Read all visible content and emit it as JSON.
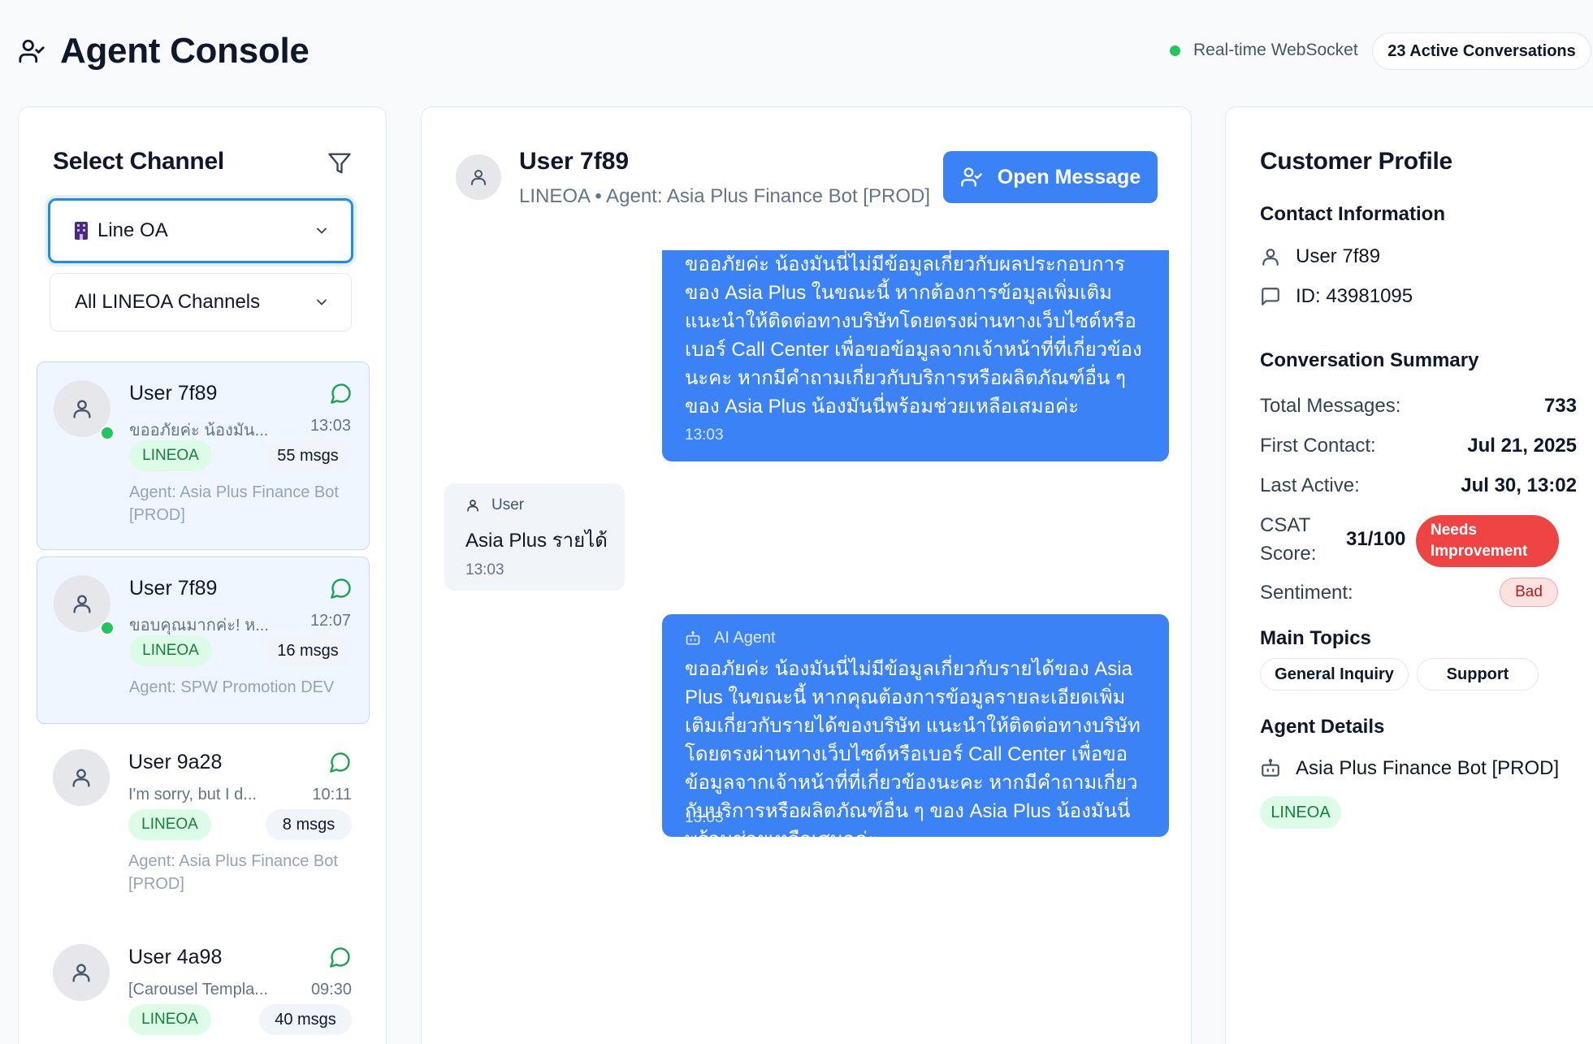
{
  "header": {
    "title": "Agent Console",
    "ws_status": "Real-time WebSocket",
    "active_conversations": "23 Active Conversations"
  },
  "channel_panel": {
    "title": "Select Channel",
    "platform_select": "Line OA",
    "channel_select": "All LINEOA Channels"
  },
  "conversations": [
    {
      "name": "User 7f89",
      "preview": "ขออภัยค่ะ น้องมัน...",
      "time": "13:03",
      "channel": "LINEOA",
      "count": "55 msgs",
      "agent": "Agent: Asia Plus Finance Bot [PROD]",
      "online": true,
      "selected": true
    },
    {
      "name": "User 7f89",
      "preview": "ขอบคุณมากค่ะ! ห...",
      "time": "12:07",
      "channel": "LINEOA",
      "count": "16 msgs",
      "agent": "Agent: SPW Promotion DEV",
      "online": true,
      "selected": true
    },
    {
      "name": "User 9a28",
      "preview": "I'm sorry, but I d...",
      "time": "10:11",
      "channel": "LINEOA",
      "count": "8 msgs",
      "agent": "Agent: Asia Plus Finance Bot [PROD]",
      "online": false,
      "selected": false
    },
    {
      "name": "User 4a98",
      "preview": "[Carousel Templa...",
      "time": "09:30",
      "channel": "LINEOA",
      "count": "40 msgs",
      "agent": "",
      "online": false,
      "selected": false
    }
  ],
  "chat": {
    "user_name": "User 7f89",
    "subtitle": "LINEOA • Agent: Asia Plus Finance Bot [PROD]",
    "open_button": "Open Message",
    "messages": [
      {
        "sender": "",
        "text": "ขออภัยค่ะ น้องมันนี่ไม่มีข้อมูลเกี่ยวกับผลประกอบการของ Asia Plus ในขณะนี้ หากต้องการข้อมูลเพิ่มเติม แนะนำให้ติดต่อทางบริษัทโดยตรงผ่านทางเว็บไซต์หรือเบอร์ Call Center เพื่อขอข้อมูลจากเจ้าหน้าที่ที่เกี่ยวข้องนะคะ หากมีคำถามเกี่ยวกับบริการหรือผลิตภัณฑ์อื่น ๆ ของ Asia Plus น้องมันนี่พร้อมช่วยเหลือเสมอค่ะ",
        "time": "13:03"
      },
      {
        "sender": "User",
        "text": "Asia Plus รายได้",
        "time": "13:03"
      },
      {
        "sender": "AI Agent",
        "text": "ขออภัยค่ะ น้องมันนี่ไม่มีข้อมูลเกี่ยวกับรายได้ของ Asia Plus ในขณะนี้ หากคุณต้องการข้อมูลรายละเอียดเพิ่มเติมเกี่ยวกับรายได้ของบริษัท แนะนำให้ติดต่อทางบริษัทโดยตรงผ่านทางเว็บไซต์หรือเบอร์ Call Center เพื่อขอข้อมูลจากเจ้าหน้าที่ที่เกี่ยวข้องนะคะ หากมีคำถามเกี่ยวกับบริการหรือผลิตภัณฑ์อื่น ๆ ของ Asia Plus น้องมันนี่พร้อมช่วยเหลือเสมอค่ะ",
        "time": "13:03"
      }
    ]
  },
  "profile": {
    "title": "Customer Profile",
    "contact_heading": "Contact Information",
    "user_name": "User 7f89",
    "user_id": "ID: 43981095",
    "summary_heading": "Conversation Summary",
    "total_messages_label": "Total Messages:",
    "total_messages": "733",
    "first_contact_label": "First Contact:",
    "first_contact": "Jul 21, 2025",
    "last_active_label": "Last Active:",
    "last_active": "Jul 30, 13:02",
    "csat_label_1": "CSAT",
    "csat_label_2": "Score:",
    "csat_score": "31/100",
    "csat_badge_1": "Needs",
    "csat_badge_2": "Improvement",
    "sentiment_label": "Sentiment:",
    "sentiment": "Bad",
    "topics_heading": "Main Topics",
    "topics": [
      "General Inquiry",
      "Support"
    ],
    "agent_heading": "Agent Details",
    "agent_name": "Asia Plus Finance Bot [PROD]",
    "agent_channel": "LINEOA"
  },
  "colors": {
    "accent": "#3b82f6",
    "online": "#22c55e",
    "danger": "#ef4444",
    "channel_tag_bg": "#dcfce7",
    "channel_tag_text": "#15803d"
  },
  "icons": {
    "brand": "user-check-icon",
    "filter": "filter-icon",
    "platform": "line-oa-icon",
    "message": "message-circle-icon",
    "bot": "bot-icon"
  }
}
